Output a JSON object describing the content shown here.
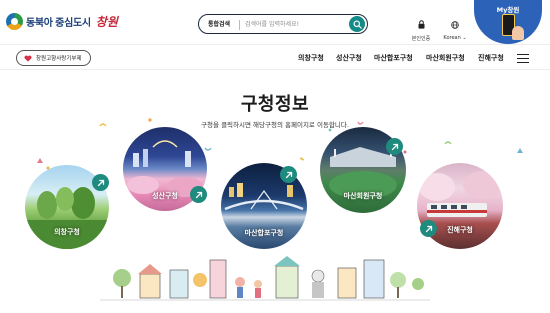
{
  "header": {
    "logo_text": "동북아 중심도시",
    "logo_script": "창원",
    "search": {
      "category": "통합검색",
      "placeholder": "검색어를 입력하세요!"
    },
    "utils": [
      {
        "label": "본인인증",
        "icon": "lock-icon"
      },
      {
        "label": "Korean",
        "icon": "globe-icon"
      }
    ],
    "my_changwon": "My창원"
  },
  "navbar": {
    "love_button": "창원고향사랑기부제",
    "items": [
      "의창구청",
      "성산구청",
      "마산합포구청",
      "마산회원구청",
      "진해구청"
    ]
  },
  "main": {
    "title": "구청정보",
    "subtitle": "구청을 클릭하시면 해당구청의 홈페이지로 이동합니다.",
    "districts": [
      {
        "label": "의창구청"
      },
      {
        "label": "성산구청"
      },
      {
        "label": "마산합포구청"
      },
      {
        "label": "마산회원구청"
      },
      {
        "label": "진해구청"
      }
    ]
  },
  "colors": {
    "accent": "#168a86",
    "brand_blue": "#2c63b8",
    "arrow_green": "#1f8a7e"
  }
}
